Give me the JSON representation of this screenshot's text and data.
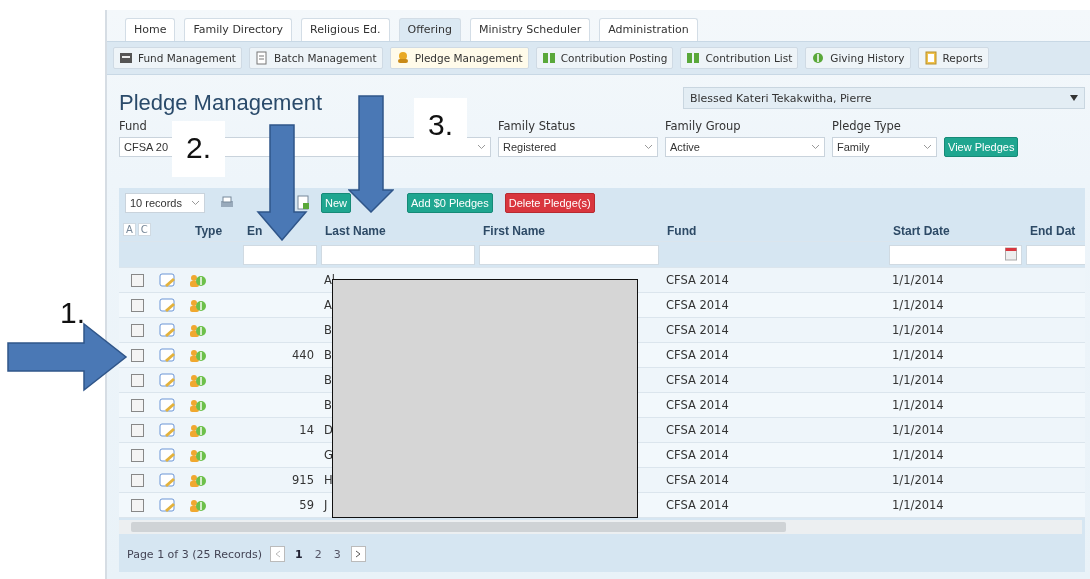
{
  "main_tabs": [
    {
      "label": "Home",
      "selected": false
    },
    {
      "label": "Family Directory",
      "selected": false
    },
    {
      "label": "Religious Ed.",
      "selected": false
    },
    {
      "label": "Offering",
      "selected": true
    },
    {
      "label": "Ministry Scheduler",
      "selected": false
    },
    {
      "label": "Administration",
      "selected": false
    }
  ],
  "sub_tabs": [
    {
      "label": "Fund Management",
      "selected": false
    },
    {
      "label": "Batch Management",
      "selected": false
    },
    {
      "label": "Pledge Management",
      "selected": true
    },
    {
      "label": "Contribution Posting",
      "selected": false
    },
    {
      "label": "Contribution List",
      "selected": false
    },
    {
      "label": "Giving History",
      "selected": false
    },
    {
      "label": "Reports",
      "selected": false
    }
  ],
  "page_title": "Pledge Management",
  "parish_select": {
    "value": "Blessed Kateri Tekakwitha, Pierre"
  },
  "filters": [
    {
      "label": "Fund",
      "value": "CFSA 20"
    },
    {
      "label": "Family Status",
      "value": "Registered"
    },
    {
      "label": "Family Group",
      "value": "Active"
    },
    {
      "label": "Pledge Type",
      "value": "Family"
    }
  ],
  "view_button": "View Pledges",
  "toolbar": {
    "page_size": "10 records",
    "buttons": [
      {
        "label": "New",
        "kind": "primary"
      },
      {
        "label": "Add $0 Pledges",
        "kind": "primary"
      },
      {
        "label": "Delete Pledge(s)",
        "kind": "danger"
      }
    ]
  },
  "table": {
    "selection_headers": [
      "A",
      "C"
    ],
    "columns": [
      "Type",
      "En",
      "Last Name",
      "First Name",
      "Fund",
      "Start Date",
      "End Dat"
    ],
    "rows": [
      {
        "checked": false,
        "envelope": "",
        "last_name": "Al",
        "fund": "CFSA 2014",
        "start_date": "1/1/2014"
      },
      {
        "checked": false,
        "envelope": "",
        "last_name": "A",
        "fund": "CFSA 2014",
        "start_date": "1/1/2014"
      },
      {
        "checked": false,
        "envelope": "",
        "last_name": "B",
        "fund": "CFSA 2014",
        "start_date": "1/1/2014"
      },
      {
        "checked": false,
        "envelope": "440",
        "last_name": "B",
        "fund": "CFSA 2014",
        "start_date": "1/1/2014"
      },
      {
        "checked": false,
        "envelope": "",
        "last_name": "B",
        "fund": "CFSA 2014",
        "start_date": "1/1/2014"
      },
      {
        "checked": false,
        "envelope": "",
        "last_name": "B",
        "fund": "CFSA 2014",
        "start_date": "1/1/2014"
      },
      {
        "checked": false,
        "envelope": "14",
        "last_name": "D",
        "fund": "CFSA 2014",
        "start_date": "1/1/2014"
      },
      {
        "checked": false,
        "envelope": "",
        "last_name": "G",
        "fund": "CFSA 2014",
        "start_date": "1/1/2014"
      },
      {
        "checked": false,
        "envelope": "915",
        "last_name": "H",
        "fund": "CFSA 2014",
        "start_date": "1/1/2014"
      },
      {
        "checked": false,
        "envelope": "59",
        "last_name": "J",
        "fund": "CFSA 2014",
        "start_date": "1/1/2014"
      }
    ]
  },
  "pager": {
    "summary": "Page 1 of 3 (25 Records)",
    "pages": [
      {
        "label": "1",
        "selected": true
      },
      {
        "label": "2",
        "selected": false
      },
      {
        "label": "3",
        "selected": false
      }
    ]
  },
  "annotations": {
    "labels": [
      "1.",
      "2.",
      "3."
    ]
  }
}
